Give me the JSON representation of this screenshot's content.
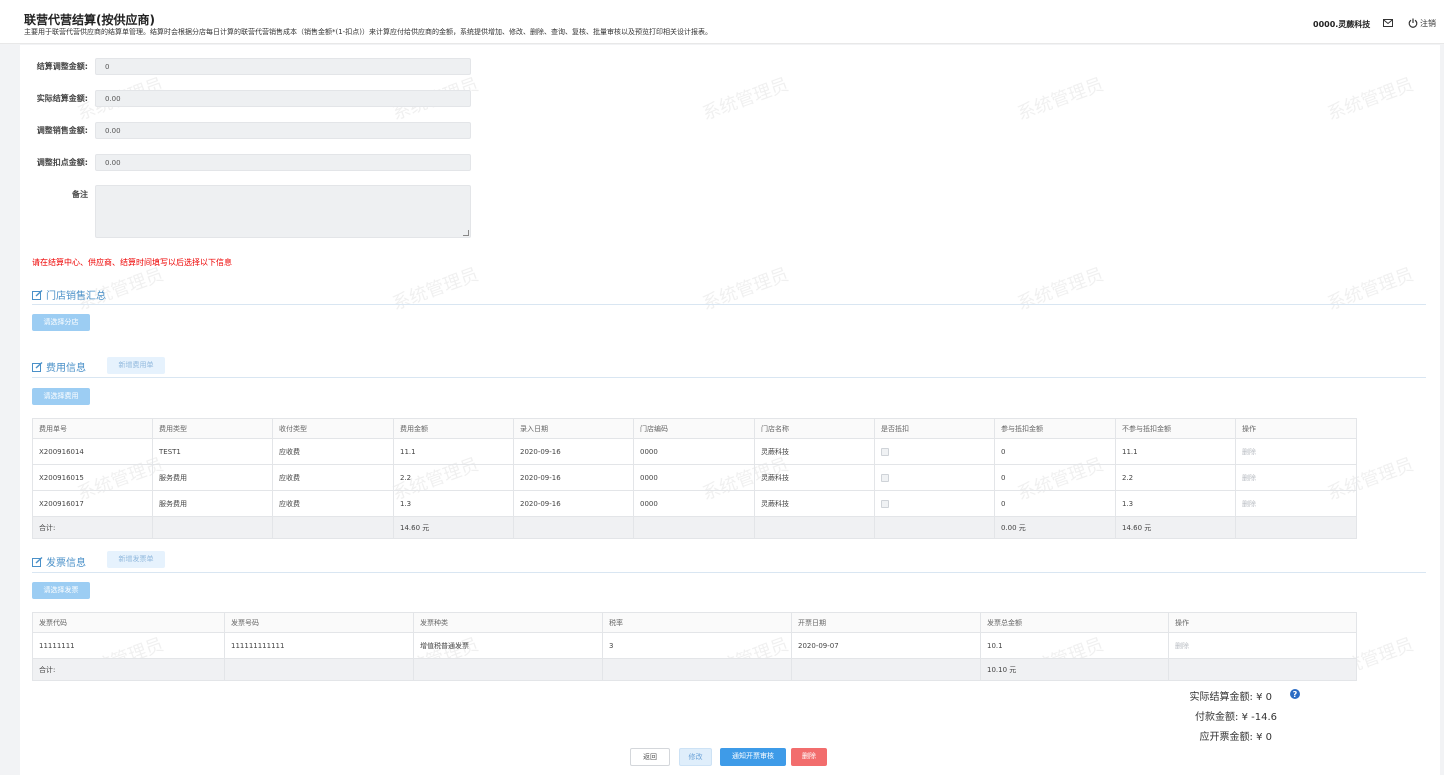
{
  "header": {
    "title": "联营代营结算(按供应商)",
    "description": "主要用于联营代营供应商的结算单管理。结算时会根据分店每日计算的联营代营销售成本（销售金额*(1-扣点)）来计算应付给供应商的金额，系统提供增加、修改、删除、查询、复核、批量审核以及预览打印相关设计报表。",
    "user": "0000.灵蕨科技",
    "mail_icon": "mail-icon",
    "power_icon": "power-icon",
    "logout": "注销"
  },
  "watermark": "系统管理员",
  "form": {
    "adjust_settle": {
      "label": "结算调整金额:",
      "value": "0"
    },
    "actual_settle": {
      "label": "实际结算金额:",
      "value": "0.00"
    },
    "adjust_sales": {
      "label": "调整销售金额:",
      "value": "0.00"
    },
    "adjust_deduct": {
      "label": "调整扣点金额:",
      "value": "0.00"
    },
    "remark": {
      "label": "备注",
      "value": ""
    }
  },
  "warning": "请在结算中心、供应商、结算时间填写以后选择以下信息",
  "store_sales": {
    "title": "门店销售汇总",
    "select_btn": "请选择分店"
  },
  "fees": {
    "title": "费用信息",
    "new_btn": "新增费用单",
    "select_btn": "请选择费用",
    "columns": [
      "费用单号",
      "费用类型",
      "收付类型",
      "费用金额",
      "录入日期",
      "门店编码",
      "门店名称",
      "是否抵扣",
      "参与抵扣金额",
      "不参与抵扣金额",
      "操作"
    ],
    "rows": [
      {
        "no": "X200916014",
        "type": "TEST1",
        "pay_type": "应收费",
        "amount": "11.1",
        "date": "2020-09-16",
        "store_code": "0000",
        "store_name": "灵蕨科技",
        "deduct_in": "0",
        "deduct_out": "11.1",
        "op": "删除"
      },
      {
        "no": "X200916015",
        "type": "服务费用",
        "pay_type": "应收费",
        "amount": "2.2",
        "date": "2020-09-16",
        "store_code": "0000",
        "store_name": "灵蕨科技",
        "deduct_in": "0",
        "deduct_out": "2.2",
        "op": "删除"
      },
      {
        "no": "X200916017",
        "type": "服务费用",
        "pay_type": "应收费",
        "amount": "1.3",
        "date": "2020-09-16",
        "store_code": "0000",
        "store_name": "灵蕨科技",
        "deduct_in": "0",
        "deduct_out": "1.3",
        "op": "删除"
      }
    ],
    "total": {
      "label": "合计:",
      "amount": "14.60 元",
      "deduct_in": "0.00 元",
      "deduct_out": "14.60 元"
    }
  },
  "invoices": {
    "title": "发票信息",
    "new_btn": "新增发票单",
    "select_btn": "请选择发票",
    "columns": [
      "发票代码",
      "发票号码",
      "发票种类",
      "税率",
      "开票日期",
      "发票总金额",
      "操作"
    ],
    "rows": [
      {
        "code": "11111111",
        "number": "111111111111",
        "kind": "增值税普通发票",
        "tax": "3",
        "date": "2020-09-07",
        "total": "10.1",
        "op": "删除"
      }
    ],
    "total": {
      "label": "合计:",
      "amount": "10.10 元"
    }
  },
  "summary": {
    "actual_settle": "实际结算金额: ¥ 0",
    "payment": "付款金额: ¥ -14.6",
    "invoice_due": "应开票金额: ¥ 0"
  },
  "buttons": {
    "back": "返回",
    "edit": "修改",
    "notify": "通知开票审核",
    "delete": "删除"
  }
}
